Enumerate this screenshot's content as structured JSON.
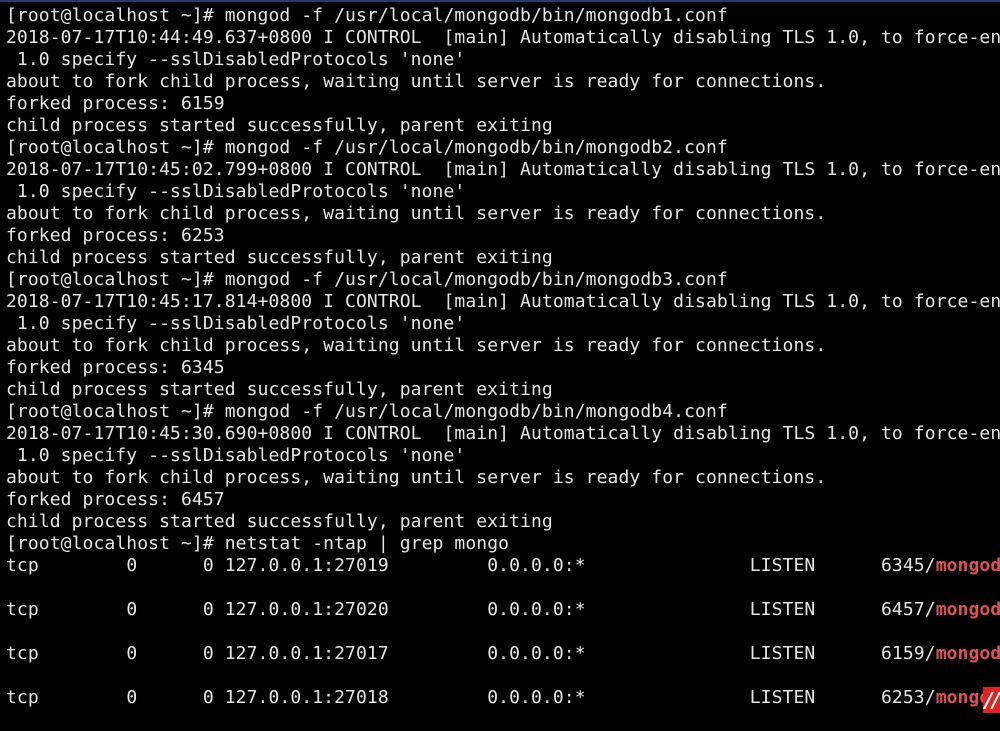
{
  "terminal": {
    "prompt": "[root@localhost ~]# ",
    "lines": [
      {
        "type": "cmd",
        "text": "mongod -f /usr/local/mongodb/bin/mongodb1.conf"
      },
      {
        "type": "out",
        "text": "2018-07-17T10:44:49.637+0800 I CONTROL  [main] Automatically disabling TLS 1.0, to force-enable TLS"
      },
      {
        "type": "out",
        "text": " 1.0 specify --sslDisabledProtocols 'none'"
      },
      {
        "type": "out",
        "text": "about to fork child process, waiting until server is ready for connections."
      },
      {
        "type": "out",
        "text": "forked process: 6159"
      },
      {
        "type": "out",
        "text": "child process started successfully, parent exiting"
      },
      {
        "type": "cmd",
        "text": "mongod -f /usr/local/mongodb/bin/mongodb2.conf"
      },
      {
        "type": "out",
        "text": "2018-07-17T10:45:02.799+0800 I CONTROL  [main] Automatically disabling TLS 1.0, to force-enable TLS"
      },
      {
        "type": "out",
        "text": " 1.0 specify --sslDisabledProtocols 'none'"
      },
      {
        "type": "out",
        "text": "about to fork child process, waiting until server is ready for connections."
      },
      {
        "type": "out",
        "text": "forked process: 6253"
      },
      {
        "type": "out",
        "text": "child process started successfully, parent exiting"
      },
      {
        "type": "cmd",
        "text": "mongod -f /usr/local/mongodb/bin/mongodb3.conf"
      },
      {
        "type": "out",
        "text": "2018-07-17T10:45:17.814+0800 I CONTROL  [main] Automatically disabling TLS 1.0, to force-enable TLS"
      },
      {
        "type": "out",
        "text": " 1.0 specify --sslDisabledProtocols 'none'"
      },
      {
        "type": "out",
        "text": "about to fork child process, waiting until server is ready for connections."
      },
      {
        "type": "out",
        "text": "forked process: 6345"
      },
      {
        "type": "out",
        "text": "child process started successfully, parent exiting"
      },
      {
        "type": "cmd",
        "text": "mongod -f /usr/local/mongodb/bin/mongodb4.conf"
      },
      {
        "type": "out",
        "text": "2018-07-17T10:45:30.690+0800 I CONTROL  [main] Automatically disabling TLS 1.0, to force-enable TLS"
      },
      {
        "type": "out",
        "text": " 1.0 specify --sslDisabledProtocols 'none'"
      },
      {
        "type": "out",
        "text": "about to fork child process, waiting until server is ready for connections."
      },
      {
        "type": "out",
        "text": "forked process: 6457"
      },
      {
        "type": "out",
        "text": "child process started successfully, parent exiting"
      },
      {
        "type": "cmd",
        "text": "netstat -ntap | grep mongo"
      }
    ],
    "netstat_rows": [
      {
        "proto": "tcp",
        "recvq": "0",
        "sendq": "0",
        "local": "127.0.0.1:27019",
        "foreign": "0.0.0.0:*",
        "state": "LISTEN",
        "pid": "6345/",
        "prog": "mongod"
      },
      {
        "proto": "tcp",
        "recvq": "0",
        "sendq": "0",
        "local": "127.0.0.1:27020",
        "foreign": "0.0.0.0:*",
        "state": "LISTEN",
        "pid": "6457/",
        "prog": "mongod"
      },
      {
        "proto": "tcp",
        "recvq": "0",
        "sendq": "0",
        "local": "127.0.0.1:27017",
        "foreign": "0.0.0.0:*",
        "state": "LISTEN",
        "pid": "6159/",
        "prog": "mongod"
      },
      {
        "proto": "tcp",
        "recvq": "0",
        "sendq": "0",
        "local": "127.0.0.1:27018",
        "foreign": "0.0.0.0:*",
        "state": "LISTEN",
        "pid": "6253/",
        "prog": "mongod"
      }
    ],
    "colors": {
      "background": "#000000",
      "text": "#e6e6e6",
      "grep_highlight": "#e0505a"
    }
  },
  "watermark": {
    "label": "//"
  }
}
